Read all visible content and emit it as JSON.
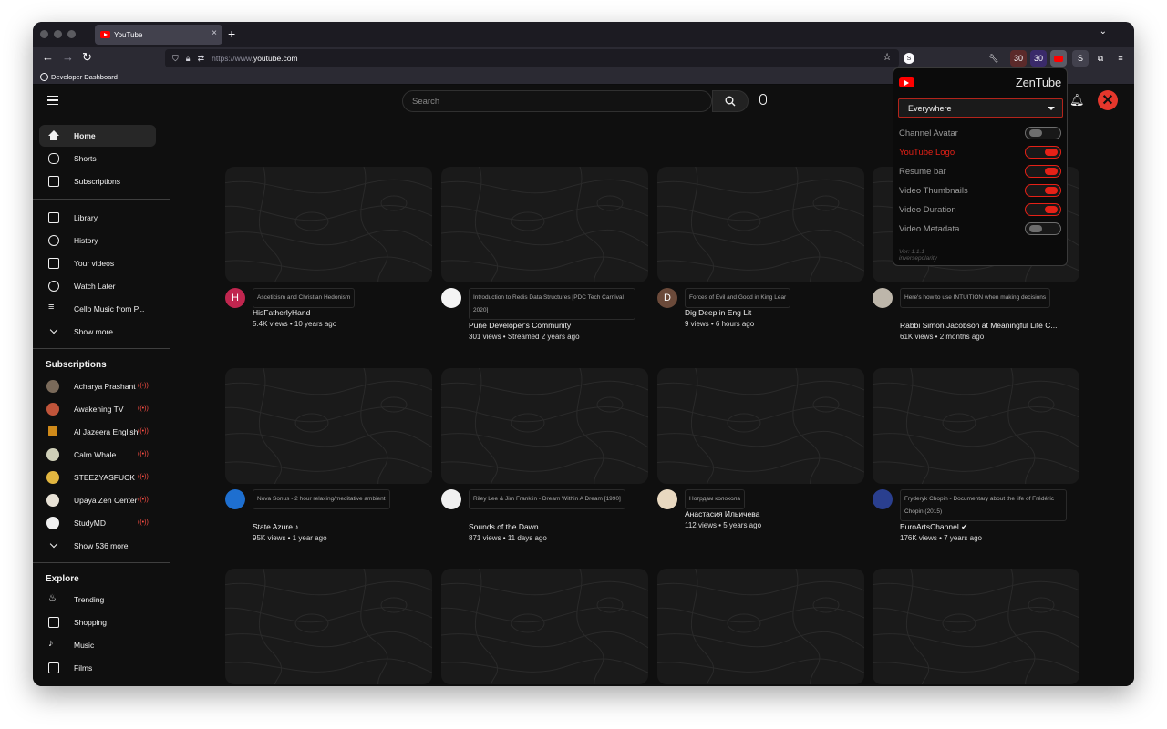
{
  "browser": {
    "tab_title": "YouTube",
    "tab_close": "×",
    "new_tab": "+",
    "tab_list": "⌄",
    "url_scheme": "https://www.",
    "url_host": "youtube.com",
    "bookmark": "Developer Dashboard",
    "ext_badge_1": "30",
    "ext_badge_2": "30"
  },
  "masthead": {
    "search_placeholder": "Search"
  },
  "sidebar": {
    "main": [
      {
        "label": "Home",
        "icon": "home-icon"
      },
      {
        "label": "Shorts",
        "icon": "shorts-icon"
      },
      {
        "label": "Subscriptions",
        "icon": "subscriptions-icon"
      }
    ],
    "library": [
      {
        "label": "Library",
        "icon": "library-icon"
      },
      {
        "label": "History",
        "icon": "history-icon"
      },
      {
        "label": "Your videos",
        "icon": "your-videos-icon"
      },
      {
        "label": "Watch Later",
        "icon": "clock-icon"
      },
      {
        "label": "Cello Music from P...",
        "icon": "playlist-icon"
      },
      {
        "label": "Show more",
        "icon": "chevron-down-icon"
      }
    ],
    "subscriptions_heading": "Subscriptions",
    "subscriptions": [
      {
        "label": "Acharya Prashant",
        "color": "#7a6a5a"
      },
      {
        "label": "Awakening TV",
        "color": "#c0543a"
      },
      {
        "label": "Al Jazeera English",
        "color": "#d08a1a"
      },
      {
        "label": "Calm Whale",
        "color": "#cfcfb8"
      },
      {
        "label": "STEEZYASFUCK",
        "color": "#e2b640"
      },
      {
        "label": "Upaya Zen Center",
        "color": "#e8e2d6"
      },
      {
        "label": "StudyMD",
        "color": "#f0f0f0"
      },
      {
        "label": "Show 536 more",
        "color": ""
      }
    ],
    "live_glyph": "((•))",
    "explore_heading": "Explore",
    "explore": [
      {
        "label": "Trending",
        "icon": "trending-icon"
      },
      {
        "label": "Shopping",
        "icon": "shopping-icon"
      },
      {
        "label": "Music",
        "icon": "music-icon"
      },
      {
        "label": "Films",
        "icon": "films-icon"
      }
    ]
  },
  "videos": [
    {
      "title": "Asceticism and Christian Hedonism",
      "channel": "HisFatherlyHand",
      "meta": "5.4K views • 10 years ago",
      "avatar_letter": "H",
      "avatar_color": "#c0264f"
    },
    {
      "title": "Introduction to Redis Data Structures [PDC Tech Carnival 2020]",
      "channel": "Pune Developer's Community",
      "meta": "301 views • Streamed 2 years ago",
      "avatar_letter": "",
      "avatar_color": "#f4f4f4"
    },
    {
      "title": "Forces of Evil and Good in King Lear",
      "channel": "Dig Deep in Eng Lit",
      "meta": "9 views • 6 hours ago",
      "avatar_letter": "D",
      "avatar_color": "#6b4a3a"
    },
    {
      "title": "Here's how to use INTUITION when making decisions",
      "channel": "Rabbi Simon Jacobson at Meaningful Life C...",
      "meta": "61K views • 2 months ago",
      "avatar_letter": "",
      "avatar_color": "#bdb6aa"
    },
    {
      "title": "Nova Sonus - 2 hour relaxing/meditative ambient",
      "channel": "State Azure ♪",
      "meta": "95K views • 1 year ago",
      "avatar_letter": "",
      "avatar_color": "#1e6fd0"
    },
    {
      "title": "Riley Lee & Jim Franklin - Dream Within A Dream [1990]",
      "channel": "Sounds of the Dawn",
      "meta": "871 views • 11 days ago",
      "avatar_letter": "",
      "avatar_color": "#f0f0f0"
    },
    {
      "title": "Нотрдам колокола",
      "channel": "Анастасия Ильичева",
      "meta": "112 views • 5 years ago",
      "avatar_letter": "",
      "avatar_color": "#e8d8c0"
    },
    {
      "title": "Fryderyk Chopin - Documentary about the life of Frédéric Chopin (2015)",
      "channel": "EuroArtsChannel ✔",
      "meta": "176K views • 7 years ago",
      "avatar_letter": "",
      "avatar_color": "#2a3f8f"
    }
  ],
  "live_label": "((•))",
  "zentube": {
    "brand": "ZenTube",
    "scope": "Everywhere",
    "toggles": [
      {
        "label": "Channel Avatar",
        "on": false
      },
      {
        "label": "YouTube Logo",
        "on": true
      },
      {
        "label": "Resume bar",
        "on": true
      },
      {
        "label": "Video Thumbnails",
        "on": true
      },
      {
        "label": "Video Duration",
        "on": true
      },
      {
        "label": "Video Metadata",
        "on": false
      }
    ],
    "version": "Ver: 1.1.1",
    "author": "inversepolarity",
    "accent": "#e62117"
  }
}
